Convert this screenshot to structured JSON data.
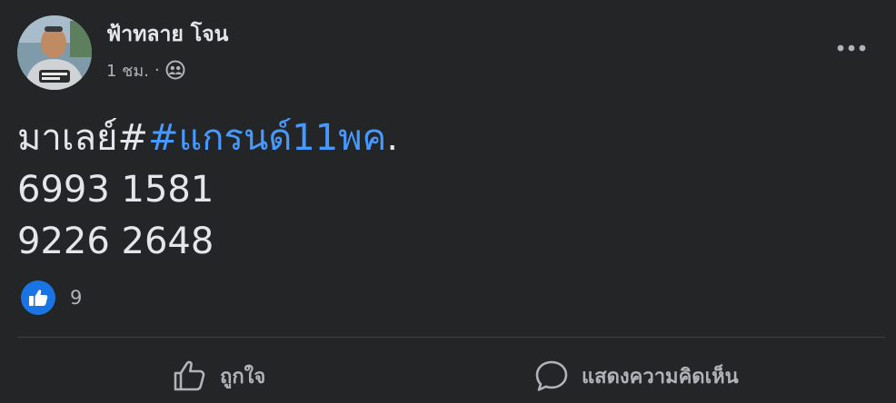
{
  "post": {
    "author": "ฟ้าทลาย โจน",
    "time": "1 ชม.",
    "separator": "·",
    "privacy_icon": "friends-icon",
    "content": {
      "prefix": "มาเลย์#",
      "hashtag": "#แกรนด์11พค",
      "suffix": ".",
      "line2": "6993 1581",
      "line3": "9226 2648"
    },
    "reactions": {
      "icon": "like-icon",
      "count": "9"
    },
    "actions": {
      "like_label": "ถูกใจ",
      "comment_label": "แสดงความคิดเห็น"
    }
  },
  "colors": {
    "background": "#242526",
    "text": "#e4e6eb",
    "secondary_text": "#b0b3b8",
    "hashtag": "#4599ff",
    "like_blue": "#1b74e4"
  }
}
